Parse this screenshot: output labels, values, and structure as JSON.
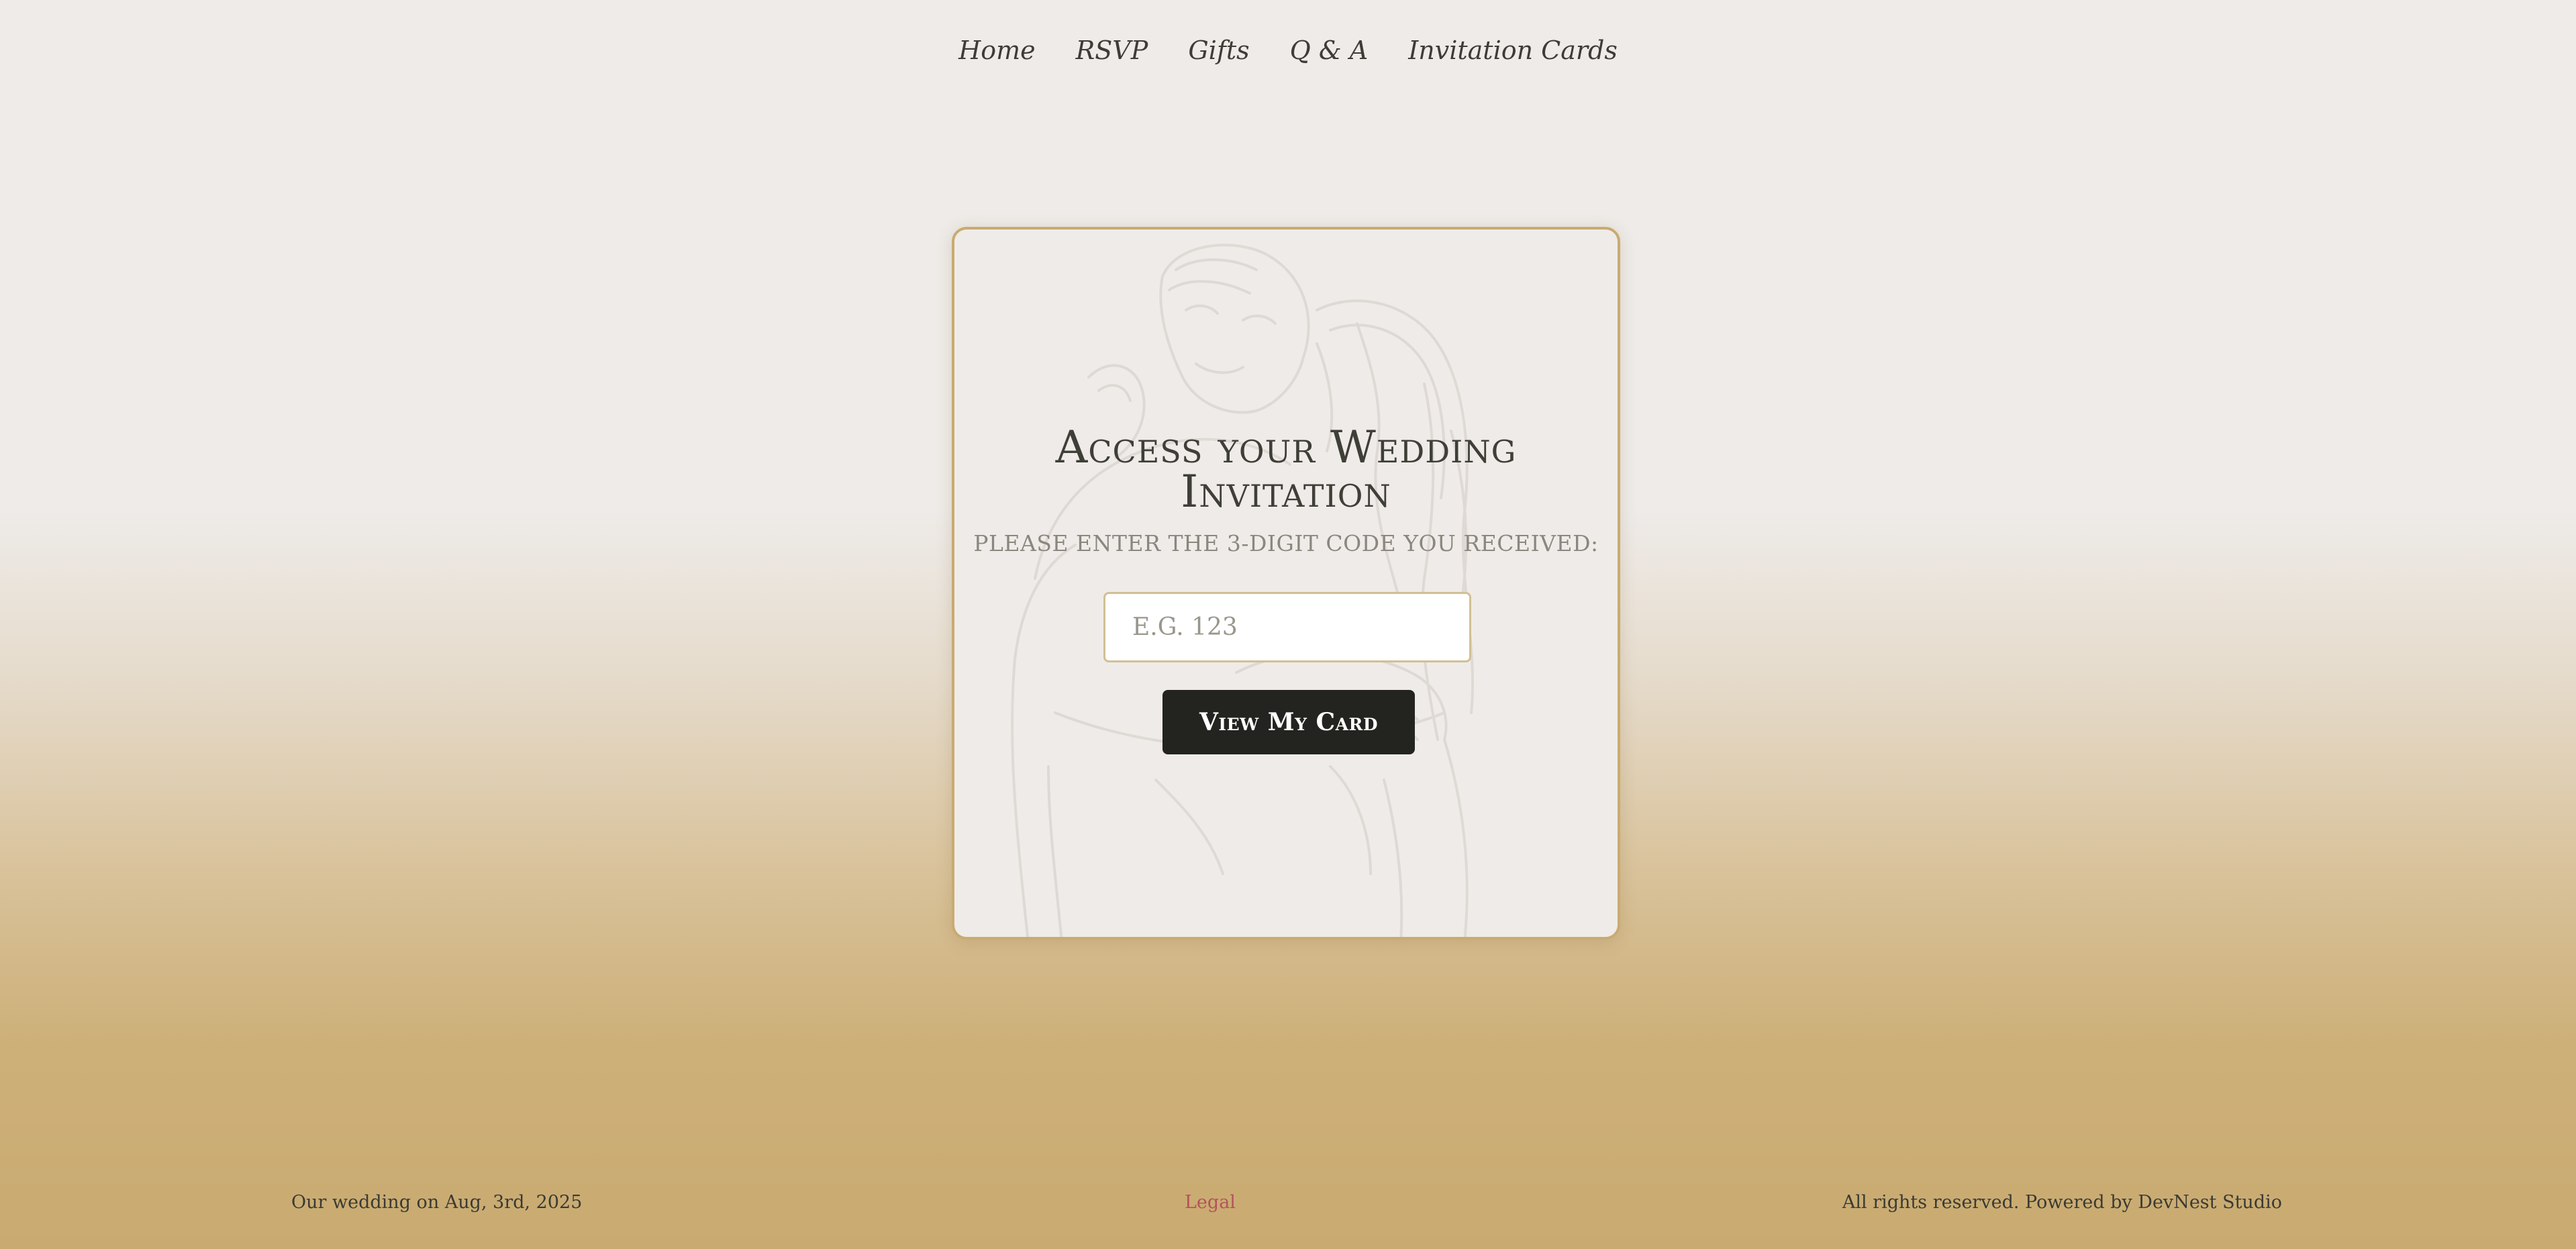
{
  "nav": {
    "items": [
      {
        "label": "Home"
      },
      {
        "label": "RSVP"
      },
      {
        "label": "Gifts"
      },
      {
        "label": "Q & A"
      },
      {
        "label": "Invitation Cards"
      }
    ]
  },
  "card": {
    "title": "Access your Wedding Invitation",
    "subtitle": "Please enter the 3-digit code you received:",
    "input": {
      "value": "",
      "placeholder": "E.G. 123"
    },
    "button_label": "View My Card",
    "illustration_icon": "couple-line-drawing"
  },
  "footer": {
    "left_text": "Our wedding on Aug, 3rd, 2025",
    "legal_link": "Legal",
    "right_text": "All rights reserved. Powered by DevNest Studio"
  },
  "colors": {
    "accent_gold": "#c9ab71",
    "button_dark": "#23241f",
    "legal_link": "#b5525a",
    "background_top": "#eeebe8",
    "background_bottom": "#c9ab71"
  }
}
